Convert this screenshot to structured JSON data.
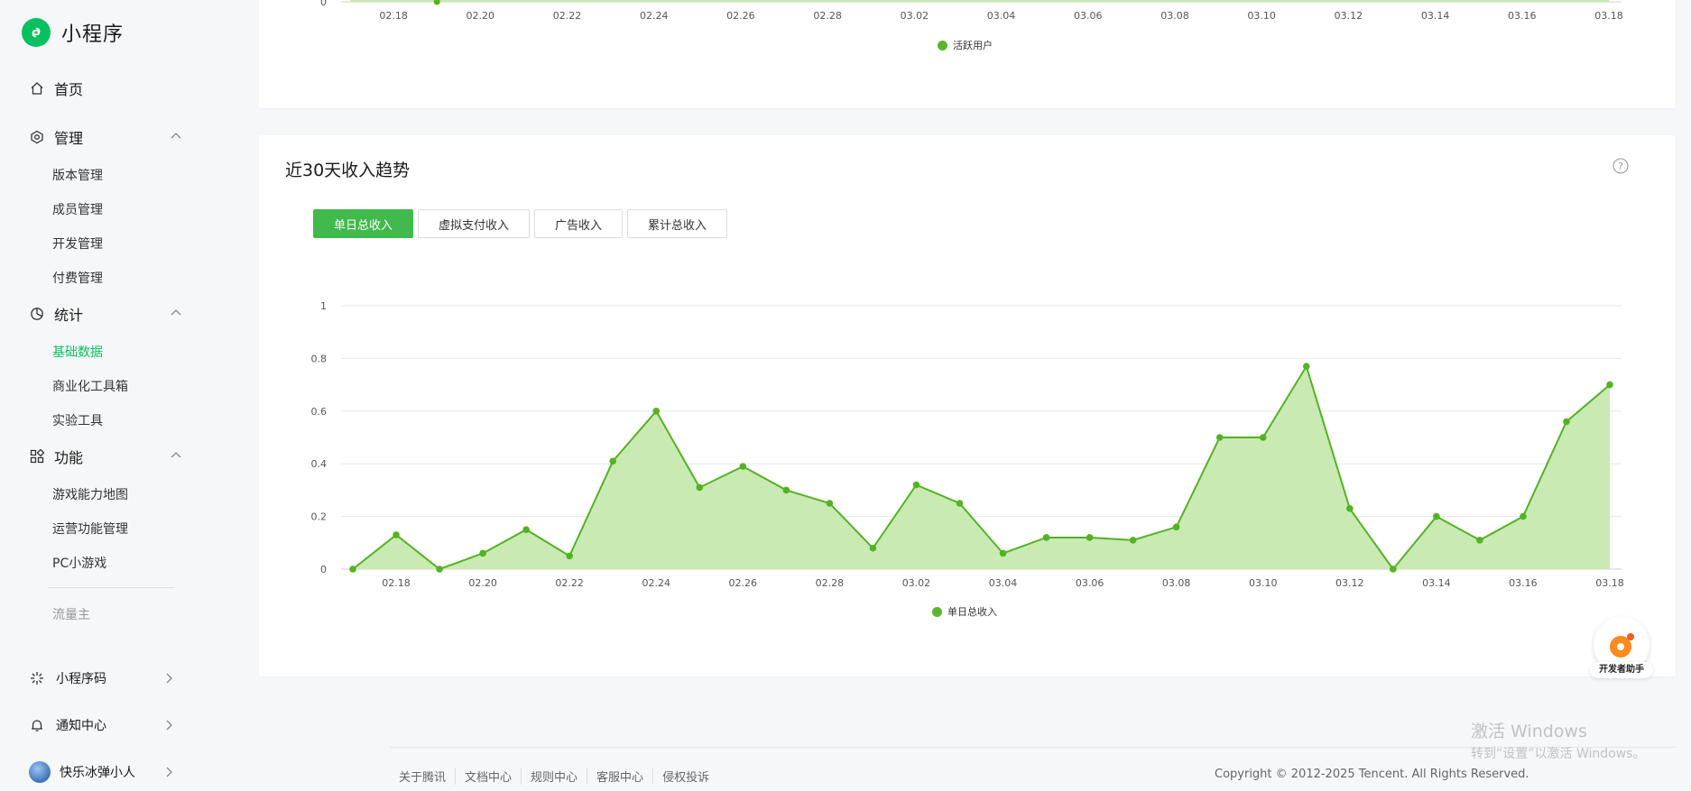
{
  "brand": {
    "title": "小程序",
    "icon": "miniprogram-logo-icon",
    "color": "#07c160"
  },
  "sidebar": {
    "home": {
      "label": "首页",
      "icon": "home-icon"
    },
    "sections": [
      {
        "label": "管理",
        "icon": "gear-hex-icon",
        "items": [
          "版本管理",
          "成员管理",
          "开发管理",
          "付费管理"
        ]
      },
      {
        "label": "统计",
        "icon": "pie-chart-icon",
        "items": [
          "基础数据",
          "商业化工具箱",
          "实验工具"
        ]
      },
      {
        "label": "功能",
        "icon": "grid-apps-icon",
        "items": [
          "游戏能力地图",
          "运营功能管理",
          "PC小游戏"
        ]
      }
    ],
    "active_item": "基础数据",
    "extra": "流量主",
    "bottom": [
      {
        "label": "小程序码",
        "icon": "qrcode-sun-icon"
      },
      {
        "label": "通知中心",
        "icon": "bell-icon"
      },
      {
        "label": "快乐冰弹小人",
        "icon": "avatar"
      }
    ]
  },
  "top_chart": {
    "y_label": "0",
    "x_ticks": [
      "02.18",
      "02.20",
      "02.22",
      "02.24",
      "02.26",
      "02.28",
      "03.02",
      "03.04",
      "03.06",
      "03.08",
      "03.10",
      "03.12",
      "03.14",
      "03.16",
      "03.18"
    ],
    "legend": "活跃用户"
  },
  "revenue": {
    "title": "近30天收入趋势",
    "tabs": [
      "单日总收入",
      "虚拟支付收入",
      "广告收入",
      "累计总收入"
    ],
    "active_tab": 0
  },
  "chart_data": {
    "type": "area",
    "title": "",
    "x": [
      "02.17",
      "02.18",
      "02.19",
      "02.20",
      "02.21",
      "02.22",
      "02.23",
      "02.24",
      "02.25",
      "02.26",
      "02.27",
      "02.28",
      "03.01",
      "03.02",
      "03.03",
      "03.04",
      "03.05",
      "03.06",
      "03.07",
      "03.08",
      "03.09",
      "03.10",
      "03.11",
      "03.12",
      "03.13",
      "03.14",
      "03.15",
      "03.16",
      "03.17",
      "03.18"
    ],
    "series": [
      {
        "name": "单日总收入",
        "values": [
          0,
          0.13,
          0,
          0.06,
          0.15,
          0.05,
          0.41,
          0.6,
          0.31,
          0.39,
          0.3,
          0.25,
          0.08,
          0.32,
          0.25,
          0.06,
          0.12,
          0.12,
          0.11,
          0.16,
          0.5,
          0.5,
          0.77,
          0.23,
          0,
          0.2,
          0.11,
          0.2,
          0.56,
          0.7
        ]
      }
    ],
    "x_ticks": [
      "02.18",
      "02.20",
      "02.22",
      "02.24",
      "02.26",
      "02.28",
      "03.02",
      "03.04",
      "03.06",
      "03.08",
      "03.10",
      "03.12",
      "03.14",
      "03.16",
      "03.18"
    ],
    "y_ticks": [
      "0",
      "0.2",
      "0.4",
      "0.6",
      "0.8",
      "1"
    ],
    "ylim": [
      0,
      1
    ],
    "grid": true,
    "legend": "bottom-center",
    "line_color": "#52b323",
    "fill_color": "#c9eab3"
  },
  "helper": {
    "label": "开发者助手",
    "icon": "developer-assistant-icon"
  },
  "footer": {
    "links": [
      "关于腾讯",
      "文档中心",
      "规则中心",
      "客服中心",
      "侵权投诉"
    ],
    "copyright": "Copyright © 2012-2025 Tencent. All Rights Reserved."
  },
  "watermark": {
    "line1": "激活 Windows",
    "line2": "转到“设置”以激活 Windows。"
  }
}
